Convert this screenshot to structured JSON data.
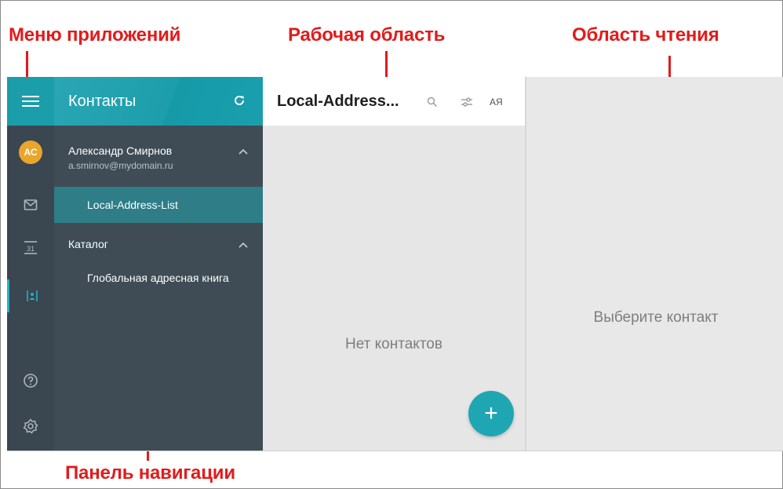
{
  "annotations": {
    "app_menu": "Меню приложений",
    "workspace": "Рабочая область",
    "reading_area": "Область чтения",
    "nav_panel": "Панель навигации"
  },
  "rail": {
    "avatar_initials": "АС",
    "items": [
      {
        "icon": "mail-icon"
      },
      {
        "icon": "calendar-icon",
        "text": "31"
      },
      {
        "icon": "contacts-icon",
        "active": true
      },
      {
        "icon": "help-icon"
      },
      {
        "icon": "gear-icon"
      }
    ]
  },
  "nav": {
    "title": "Контакты",
    "account_name": "Александр Смирнов",
    "account_email": "a.smirnov@mydomain.ru",
    "selected_item": "Local-Address-List",
    "catalog": "Каталог",
    "global_book": "Глобальная адресная книга"
  },
  "workspace": {
    "title": "Local-Address...",
    "sort_label": "АЯ",
    "empty_text": "Нет контактов",
    "fab_symbol": "+"
  },
  "reading": {
    "placeholder": "Выберите контакт"
  },
  "colors": {
    "accent": "#1b9daa",
    "rail_bg": "#3a4650",
    "nav_bg": "#3f4c56",
    "annotation": "#e21b1b"
  }
}
